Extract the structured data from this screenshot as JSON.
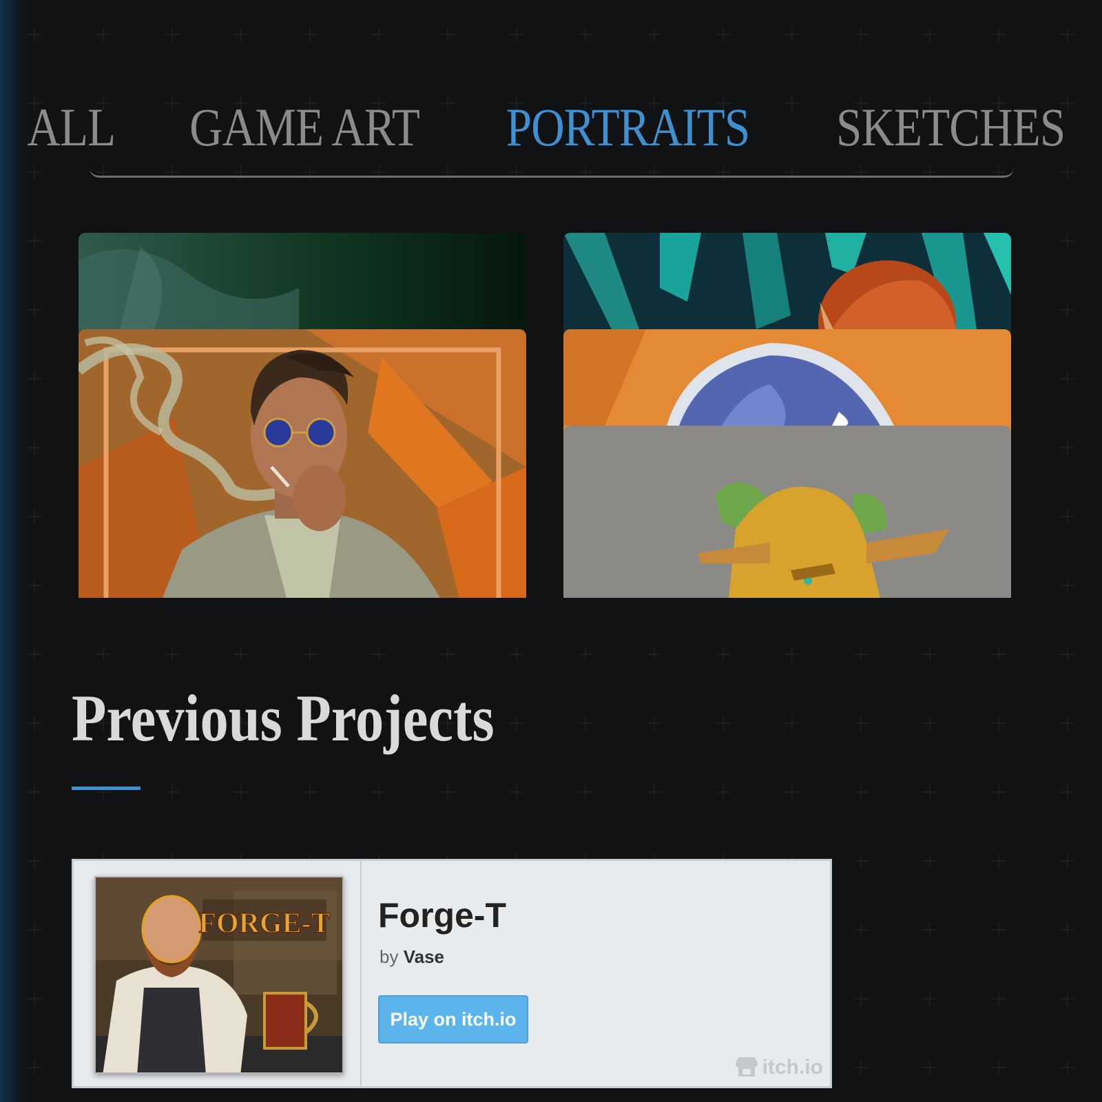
{
  "filters": [
    {
      "label": "ALL",
      "active": false
    },
    {
      "label": "GAME ART",
      "active": false
    },
    {
      "label": "PORTRAITS",
      "active": true
    },
    {
      "label": "SKETCHES",
      "active": false
    }
  ],
  "gallery": {
    "cards": [
      {
        "name": "portrait-green-painting"
      },
      {
        "name": "portrait-smoking-man"
      },
      {
        "name": "portrait-red-hair-teal-bg"
      },
      {
        "name": "portrait-blue-hair-orange-bg"
      },
      {
        "name": "portrait-elf-gold-hood"
      }
    ]
  },
  "section": {
    "title": "Previous Projects"
  },
  "itch": {
    "game_title": "Forge-T",
    "by_label": "by",
    "author": "Vase",
    "play_label": "Play on itch.io",
    "badge_label": "itch.io",
    "thumb_logo_text": "FORGE-T"
  },
  "colors": {
    "accent": "#3f90d0",
    "background": "#111213",
    "button": "#5bb5ec",
    "widget_bg": "#e7ebee"
  }
}
